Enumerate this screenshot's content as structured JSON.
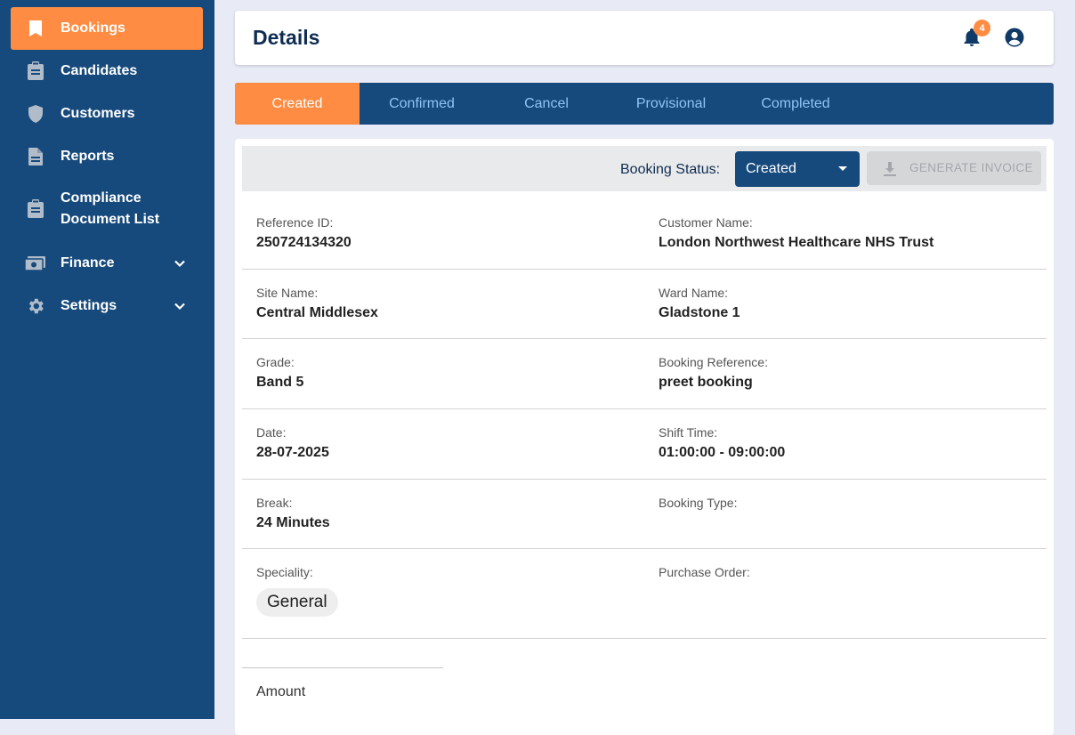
{
  "sidebar": {
    "items": [
      {
        "label": "Bookings",
        "icon": "bookmark-icon",
        "active": true
      },
      {
        "label": "Candidates",
        "icon": "clipboard-icon"
      },
      {
        "label": "Customers",
        "icon": "shield-icon"
      },
      {
        "label": "Reports",
        "icon": "document-icon"
      },
      {
        "label": "Compliance Document List",
        "label_line1": "Compliance",
        "label_line2": "Document List",
        "icon": "clipboard-icon"
      },
      {
        "label": "Finance",
        "icon": "money-icon",
        "expandable": true
      },
      {
        "label": "Settings",
        "icon": "gear-icon",
        "expandable": true
      }
    ]
  },
  "header": {
    "title": "Details",
    "notification_count": "4"
  },
  "tabs": [
    {
      "label": "Created",
      "active": true
    },
    {
      "label": "Confirmed"
    },
    {
      "label": "Cancel"
    },
    {
      "label": "Provisional"
    },
    {
      "label": "Completed"
    }
  ],
  "status_bar": {
    "label": "Booking Status:",
    "selected": "Created",
    "generate_invoice_label": "GENERATE INVOICE"
  },
  "details": {
    "reference_id": {
      "label": "Reference ID:",
      "value": "250724134320"
    },
    "customer_name": {
      "label": "Customer Name:",
      "value": "London Northwest Healthcare NHS Trust"
    },
    "site_name": {
      "label": "Site Name:",
      "value": "Central Middlesex"
    },
    "ward_name": {
      "label": "Ward Name:",
      "value": "Gladstone 1"
    },
    "grade": {
      "label": "Grade:",
      "value": "Band 5"
    },
    "booking_reference": {
      "label": "Booking Reference:",
      "value": "preet booking"
    },
    "date": {
      "label": "Date:",
      "value": "28-07-2025"
    },
    "shift_time": {
      "label": "Shift Time:",
      "value": "01:00:00 - 09:00:00"
    },
    "break": {
      "label": "Break:",
      "value": "24 Minutes"
    },
    "booking_type": {
      "label": "Booking Type:",
      "value": ""
    },
    "speciality": {
      "label": "Speciality:",
      "value": "General"
    },
    "purchase_order": {
      "label": "Purchase Order:",
      "value": ""
    }
  },
  "amount": {
    "label": "Amount"
  },
  "colors": {
    "sidebar": "#174a7c",
    "accent": "#ff8c42",
    "tab_text": "#90c2f5",
    "title": "#0f2d52"
  }
}
